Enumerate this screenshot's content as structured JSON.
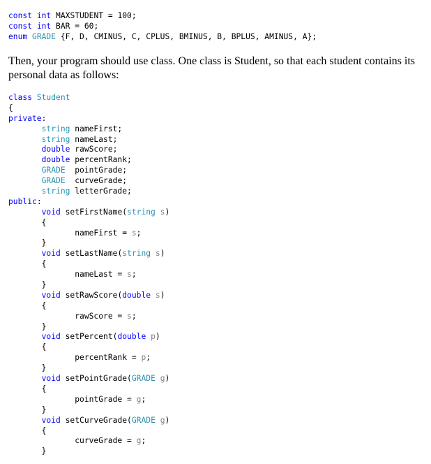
{
  "colors": {
    "keyword": "#0000ff",
    "type": "#2b91af",
    "parameter": "#808080",
    "text": "#000000"
  },
  "code_header": [
    [
      {
        "t": "const",
        "c": "kw"
      },
      {
        "t": " "
      },
      {
        "t": "int",
        "c": "kw"
      },
      {
        "t": " MAXSTUDENT = 100;"
      }
    ],
    [
      {
        "t": "const",
        "c": "kw"
      },
      {
        "t": " "
      },
      {
        "t": "int",
        "c": "kw"
      },
      {
        "t": " BAR = 60;"
      }
    ],
    [
      {
        "t": "enum",
        "c": "kw"
      },
      {
        "t": " "
      },
      {
        "t": "GRADE",
        "c": "ty"
      },
      {
        "t": " {F, D, CMINUS, C, CPLUS, BMINUS, B, BPLUS, AMINUS, A};"
      }
    ]
  ],
  "paragraph": "Then, your program should use class.  One class is Student, so that each student contains its personal data as follows:",
  "code_class": [
    [
      {
        "t": "class",
        "c": "kw"
      },
      {
        "t": " "
      },
      {
        "t": "Student",
        "c": "ty"
      }
    ],
    [
      {
        "t": "{"
      }
    ],
    [
      {
        "t": "private",
        "c": "kw"
      },
      {
        "t": ":"
      }
    ],
    [
      {
        "t": "       "
      },
      {
        "t": "string",
        "c": "ty"
      },
      {
        "t": " nameFirst;"
      }
    ],
    [
      {
        "t": "       "
      },
      {
        "t": "string",
        "c": "ty"
      },
      {
        "t": " nameLast;"
      }
    ],
    [
      {
        "t": "       "
      },
      {
        "t": "double",
        "c": "kw"
      },
      {
        "t": " rawScore;"
      }
    ],
    [
      {
        "t": "       "
      },
      {
        "t": "double",
        "c": "kw"
      },
      {
        "t": " percentRank;"
      }
    ],
    [
      {
        "t": "       "
      },
      {
        "t": "GRADE",
        "c": "ty"
      },
      {
        "t": "  pointGrade;"
      }
    ],
    [
      {
        "t": "       "
      },
      {
        "t": "GRADE",
        "c": "ty"
      },
      {
        "t": "  curveGrade;"
      }
    ],
    [
      {
        "t": "       "
      },
      {
        "t": "string",
        "c": "ty"
      },
      {
        "t": " letterGrade;"
      }
    ],
    [
      {
        "t": "public",
        "c": "kw"
      },
      {
        "t": ":"
      }
    ],
    [
      {
        "t": "       "
      },
      {
        "t": "void",
        "c": "kw"
      },
      {
        "t": " setFirstName("
      },
      {
        "t": "string",
        "c": "ty"
      },
      {
        "t": " "
      },
      {
        "t": "s",
        "c": "pm"
      },
      {
        "t": ")"
      }
    ],
    [
      {
        "t": "       {"
      }
    ],
    [
      {
        "t": "              nameFirst = "
      },
      {
        "t": "s",
        "c": "pm"
      },
      {
        "t": ";"
      }
    ],
    [
      {
        "t": "       }"
      }
    ],
    [
      {
        "t": "       "
      },
      {
        "t": "void",
        "c": "kw"
      },
      {
        "t": " setLastName("
      },
      {
        "t": "string",
        "c": "ty"
      },
      {
        "t": " "
      },
      {
        "t": "s",
        "c": "pm"
      },
      {
        "t": ")"
      }
    ],
    [
      {
        "t": "       {"
      }
    ],
    [
      {
        "t": "              nameLast = "
      },
      {
        "t": "s",
        "c": "pm"
      },
      {
        "t": ";"
      }
    ],
    [
      {
        "t": "       }"
      }
    ],
    [
      {
        "t": "       "
      },
      {
        "t": "void",
        "c": "kw"
      },
      {
        "t": " setRawScore("
      },
      {
        "t": "double",
        "c": "kw"
      },
      {
        "t": " "
      },
      {
        "t": "s",
        "c": "pm"
      },
      {
        "t": ")"
      }
    ],
    [
      {
        "t": "       {"
      }
    ],
    [
      {
        "t": "              rawScore = "
      },
      {
        "t": "s",
        "c": "pm"
      },
      {
        "t": ";"
      }
    ],
    [
      {
        "t": "       }"
      }
    ],
    [
      {
        "t": "       "
      },
      {
        "t": "void",
        "c": "kw"
      },
      {
        "t": " setPercent("
      },
      {
        "t": "double",
        "c": "kw"
      },
      {
        "t": " "
      },
      {
        "t": "p",
        "c": "pm"
      },
      {
        "t": ")"
      }
    ],
    [
      {
        "t": "       {"
      }
    ],
    [
      {
        "t": "              percentRank = "
      },
      {
        "t": "p",
        "c": "pm"
      },
      {
        "t": ";"
      }
    ],
    [
      {
        "t": "       }"
      }
    ],
    [
      {
        "t": "       "
      },
      {
        "t": "void",
        "c": "kw"
      },
      {
        "t": " setPointGrade("
      },
      {
        "t": "GRADE",
        "c": "ty"
      },
      {
        "t": " "
      },
      {
        "t": "g",
        "c": "pm"
      },
      {
        "t": ")"
      }
    ],
    [
      {
        "t": "       {"
      }
    ],
    [
      {
        "t": "              pointGrade = "
      },
      {
        "t": "g",
        "c": "pm"
      },
      {
        "t": ";"
      }
    ],
    [
      {
        "t": "       }"
      }
    ],
    [
      {
        "t": "       "
      },
      {
        "t": "void",
        "c": "kw"
      },
      {
        "t": " setCurveGrade("
      },
      {
        "t": "GRADE",
        "c": "ty"
      },
      {
        "t": " "
      },
      {
        "t": "g",
        "c": "pm"
      },
      {
        "t": ")"
      }
    ],
    [
      {
        "t": "       {"
      }
    ],
    [
      {
        "t": "              curveGrade = "
      },
      {
        "t": "g",
        "c": "pm"
      },
      {
        "t": ";"
      }
    ],
    [
      {
        "t": "       }"
      }
    ]
  ]
}
